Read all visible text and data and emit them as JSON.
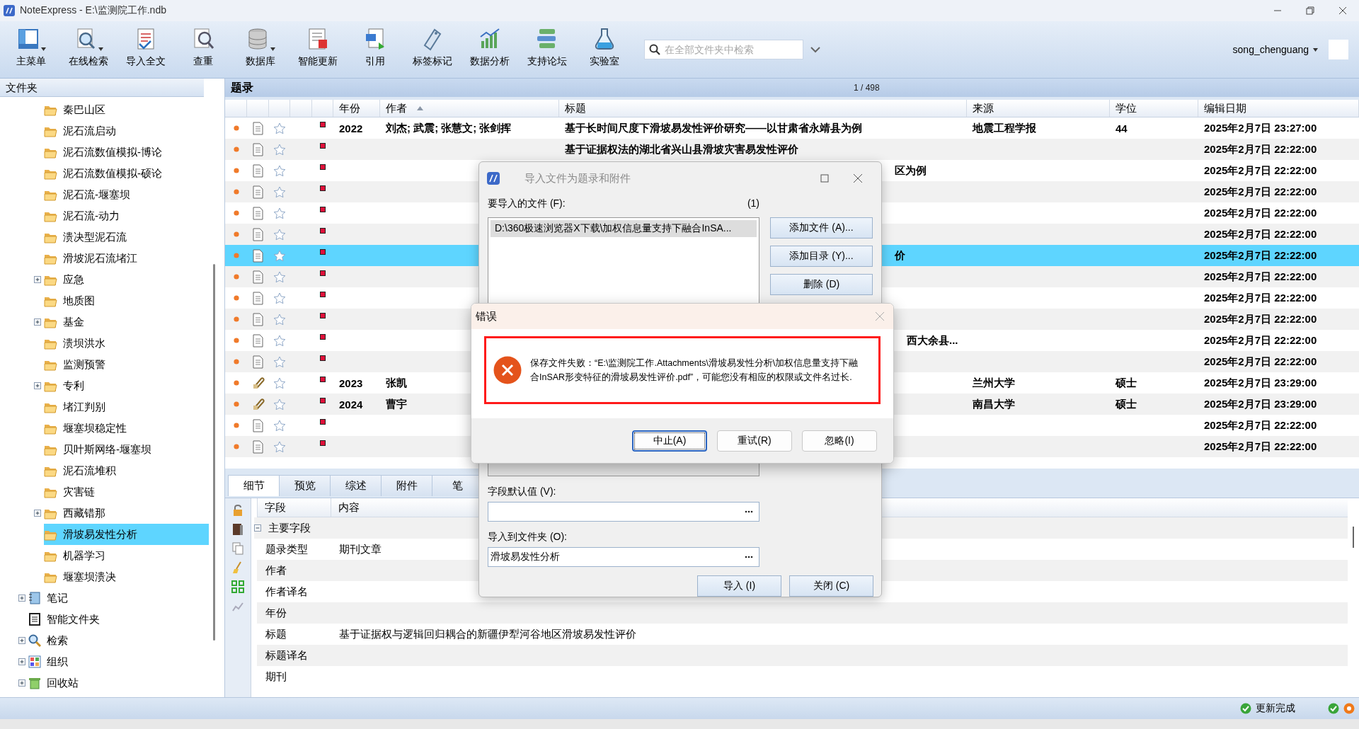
{
  "window": {
    "title": "NoteExpress - E:\\监测院工作.ndb"
  },
  "toolbar": {
    "buttons": [
      {
        "label": "主菜单",
        "has_menu": true
      },
      {
        "label": "在线检索",
        "has_menu": true
      },
      {
        "label": "导入全文",
        "has_menu": false
      },
      {
        "label": "查重",
        "has_menu": false
      },
      {
        "label": "数据库",
        "has_menu": true
      },
      {
        "label": "智能更新",
        "has_menu": false
      },
      {
        "label": "引用",
        "has_menu": false
      },
      {
        "label": "标签标记",
        "has_menu": false
      },
      {
        "label": "数据分析",
        "has_menu": false
      },
      {
        "label": "支持论坛",
        "has_menu": false
      },
      {
        "label": "实验室",
        "has_menu": false
      }
    ],
    "search": {
      "placeholder": "在全部文件夹中检索"
    },
    "user": {
      "name": "song_chenguang"
    }
  },
  "folder_tree": {
    "header": "文件夹",
    "folders": [
      {
        "label": "秦巴山区",
        "has_children": false,
        "selected": false
      },
      {
        "label": "泥石流启动",
        "has_children": false,
        "selected": false
      },
      {
        "label": "泥石流数值模拟-博论",
        "has_children": false,
        "selected": false
      },
      {
        "label": "泥石流数值模拟-硕论",
        "has_children": false,
        "selected": false
      },
      {
        "label": "泥石流-堰塞坝",
        "has_children": false,
        "selected": false
      },
      {
        "label": "泥石流-动力",
        "has_children": false,
        "selected": false
      },
      {
        "label": "溃决型泥石流",
        "has_children": false,
        "selected": false
      },
      {
        "label": "滑坡泥石流堵江",
        "has_children": false,
        "selected": false
      },
      {
        "label": "应急",
        "has_children": true,
        "selected": false
      },
      {
        "label": "地质图",
        "has_children": false,
        "selected": false
      },
      {
        "label": "基金",
        "has_children": true,
        "selected": false
      },
      {
        "label": "溃坝洪水",
        "has_children": false,
        "selected": false
      },
      {
        "label": "监测预警",
        "has_children": false,
        "selected": false
      },
      {
        "label": "专利",
        "has_children": true,
        "selected": false
      },
      {
        "label": "堵江判别",
        "has_children": false,
        "selected": false
      },
      {
        "label": "堰塞坝稳定性",
        "has_children": false,
        "selected": false
      },
      {
        "label": "贝叶斯网络-堰塞坝",
        "has_children": false,
        "selected": false
      },
      {
        "label": "泥石流堆积",
        "has_children": false,
        "selected": false
      },
      {
        "label": "灾害链",
        "has_children": false,
        "selected": false
      },
      {
        "label": "西藏错那",
        "has_children": true,
        "selected": false
      },
      {
        "label": "滑坡易发性分析",
        "has_children": false,
        "selected": true
      },
      {
        "label": "机器学习",
        "has_children": false,
        "selected": false
      },
      {
        "label": "堰塞坝溃决",
        "has_children": false,
        "selected": false
      }
    ],
    "roots": [
      {
        "label": "笔记",
        "has_children": true
      },
      {
        "label": "智能文件夹",
        "has_children": false
      },
      {
        "label": "检索",
        "has_children": true
      },
      {
        "label": "组织",
        "has_children": true
      },
      {
        "label": "回收站",
        "has_children": true
      }
    ]
  },
  "references": {
    "header": "题录",
    "count": "1 / 498",
    "columns": [
      {
        "label": "年份"
      },
      {
        "label": "作者",
        "sorted_ascending": true
      },
      {
        "label": "标题"
      },
      {
        "label": "来源"
      },
      {
        "label": "学位"
      },
      {
        "label": "编辑日期"
      }
    ],
    "rows": [
      {
        "kind": "document",
        "selected": false,
        "year": "2022",
        "authors": "刘杰; 武震; 张慧文; 张剑挥",
        "title": "基于长时间尺度下滑坡易发性评价研究——以甘肃省永靖县为例",
        "source": "地震工程学报",
        "degree": "44",
        "date": "2025年2月7日 23:27:00"
      },
      {
        "kind": "document",
        "selected": false,
        "title": "基于证据权法的湖北省兴山县滑坡灾害易发性评价",
        "date": "2025年2月7日 22:22:00"
      },
      {
        "kind": "document",
        "selected": false,
        "title": "区为例",
        "date": "2025年2月7日 22:22:00"
      },
      {
        "kind": "document",
        "selected": false,
        "date": "2025年2月7日 22:22:00"
      },
      {
        "kind": "document",
        "selected": false,
        "date": "2025年2月7日 22:22:00"
      },
      {
        "kind": "document",
        "selected": false,
        "date": "2025年2月7日 22:22:00"
      },
      {
        "kind": "document",
        "selected": true,
        "title": "价",
        "date": "2025年2月7日 22:22:00"
      },
      {
        "kind": "document",
        "selected": false,
        "date": "2025年2月7日 22:22:00"
      },
      {
        "kind": "document",
        "selected": false,
        "date": "2025年2月7日 22:22:00"
      },
      {
        "kind": "document",
        "selected": false,
        "date": "2025年2月7日 22:22:00"
      },
      {
        "kind": "document",
        "selected": false,
        "title": "西大余县...",
        "date": "2025年2月7日 22:22:00"
      },
      {
        "kind": "document",
        "selected": false,
        "date": "2025年2月7日 22:22:00"
      },
      {
        "kind": "attachment",
        "selected": false,
        "year": "2023",
        "authors": "张凯",
        "source": "兰州大学",
        "degree": "硕士",
        "date": "2025年2月7日 23:29:00"
      },
      {
        "kind": "attachment",
        "selected": false,
        "year": "2024",
        "authors": "曹宇",
        "source": "南昌大学",
        "degree": "硕士",
        "date": "2025年2月7日 23:29:00"
      },
      {
        "kind": "document",
        "selected": false,
        "date": "2025年2月7日 22:22:00"
      },
      {
        "kind": "document",
        "selected": false,
        "date": "2025年2月7日 22:22:00"
      }
    ]
  },
  "detail": {
    "tabs": [
      {
        "label": "细节",
        "selected": true
      },
      {
        "label": "预览",
        "selected": false
      },
      {
        "label": "综述",
        "selected": false
      },
      {
        "label": "附件",
        "selected": false
      },
      {
        "label": "笔",
        "selected": false
      }
    ],
    "columns": [
      "字段",
      "内容"
    ],
    "group": {
      "label": "主要字段",
      "expanded": true
    },
    "rows": [
      {
        "field": "题录类型",
        "value": "期刊文章"
      },
      {
        "field": "作者"
      },
      {
        "field": "作者译名"
      },
      {
        "field": "年份"
      },
      {
        "field": "标题",
        "value": "基于证据权与逻辑回归耦合的新疆伊犁河谷地区滑坡易发性评价"
      },
      {
        "field": "标题译名"
      },
      {
        "field": "期刊"
      }
    ]
  },
  "status_bar": {
    "message": "更新完成"
  },
  "import_dialog": {
    "title": "导入文件为题录和附件",
    "files_label": "要导入的文件 (F):",
    "files_count": "(1)",
    "files": [
      {
        "path": "D:\\360极速浏览器X下载\\加权信息量支持下融合InSA...",
        "selected": true
      }
    ],
    "side_buttons": [
      "添加文件 (A)...",
      "添加目录 (Y)...",
      "删除 (D)"
    ],
    "default_label": "字段默认值 (V):",
    "folder_label": "导入到文件夹 (O):",
    "folder_value": "滑坡易发性分析",
    "buttons": [
      "导入 (I)",
      "关闭 (C)"
    ]
  },
  "error_dialog": {
    "title": "错误",
    "message": "保存文件失败：“E:\\监测院工作.Attachments\\滑坡易发性分析\\加权信息量支持下融合InSAR形变特征的滑坡易发性评价.pdf”，可能您没有相应的权限或文件名过长.",
    "buttons": [
      {
        "label": "中止(A)",
        "focused": true
      },
      {
        "label": "重试(R)",
        "focused": false
      },
      {
        "label": "忽略(I)",
        "focused": false
      }
    ]
  }
}
